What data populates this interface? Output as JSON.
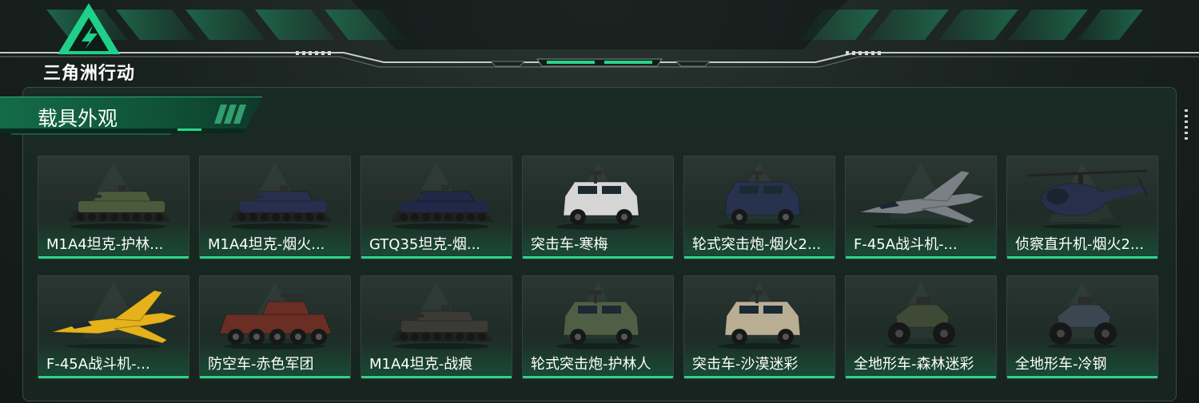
{
  "brand": {
    "logo_text": "三角洲行动"
  },
  "colors": {
    "accent": "#2bd38a",
    "panel_border": "#3d4a45",
    "card_bg": "#24302b"
  },
  "section": {
    "title": "载具外观"
  },
  "cards": [
    {
      "label": "M1A4坦克-护林...",
      "icon": "tank-icon",
      "camo": "#4a5a3a"
    },
    {
      "label": "M1A4坦克-烟火...",
      "icon": "tank-icon",
      "camo": "#26304e"
    },
    {
      "label": "GTQ35坦克-烟...",
      "icon": "tank-icon",
      "camo": "#1f2947"
    },
    {
      "label": "突击车-寒梅",
      "icon": "armored-car-icon",
      "camo": "#d6d6d6"
    },
    {
      "label": "轮式突击炮-烟火2...",
      "icon": "armored-car-icon",
      "camo": "#27324f"
    },
    {
      "label": "F-45A战斗机-...",
      "icon": "fighter-jet-icon",
      "camo": "#7b7f86"
    },
    {
      "label": "侦察直升机-烟火2...",
      "icon": "helicopter-icon",
      "camo": "#26304a"
    },
    {
      "label": "F-45A战斗机-...",
      "icon": "fighter-jet-icon",
      "camo": "#e5b21c"
    },
    {
      "label": "防空车-赤色军团",
      "icon": "apc-icon",
      "camo": "#6a2e25"
    },
    {
      "label": "M1A4坦克-战痕",
      "icon": "tank-icon",
      "camo": "#3b3a35"
    },
    {
      "label": "轮式突击炮-护林人",
      "icon": "armored-car-icon",
      "camo": "#4f5e45"
    },
    {
      "label": "突击车-沙漠迷彩",
      "icon": "armored-car-icon",
      "camo": "#b9ad94"
    },
    {
      "label": "全地形车-森林迷彩",
      "icon": "atv-icon",
      "camo": "#3f4a36"
    },
    {
      "label": "全地形车-冷钢",
      "icon": "atv-icon",
      "camo": "#3a4650"
    }
  ]
}
